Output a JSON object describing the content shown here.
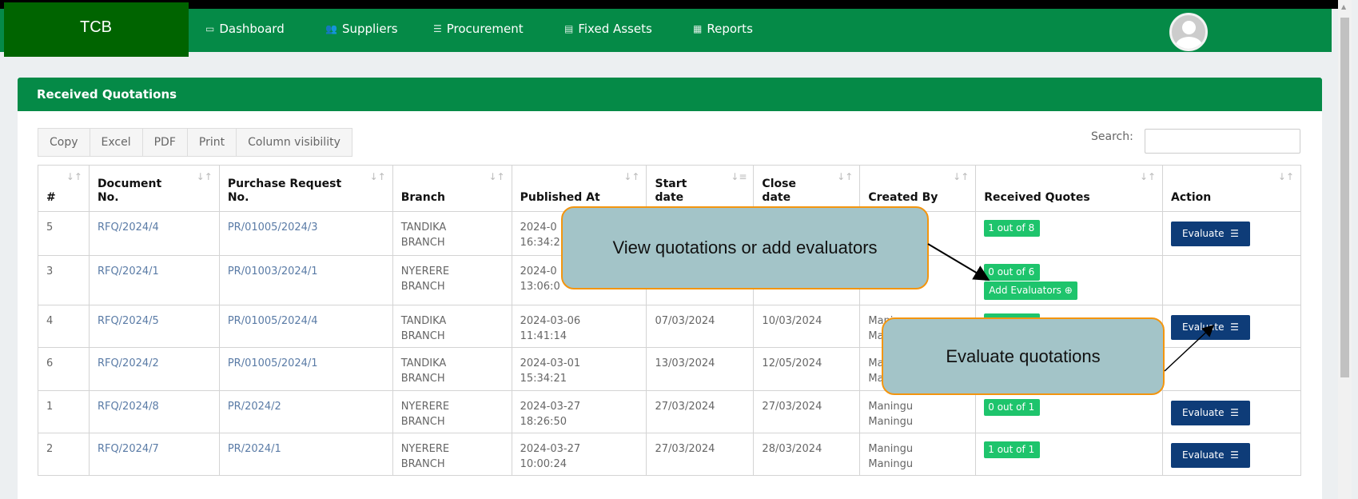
{
  "app": {
    "brand": "TCB"
  },
  "nav": [
    {
      "label": "Dashboard",
      "icon": "monitor-icon"
    },
    {
      "label": "Suppliers",
      "icon": "users-icon"
    },
    {
      "label": "Procurement",
      "icon": "list-icon"
    },
    {
      "label": "Fixed Assets",
      "icon": "building-icon"
    },
    {
      "label": "Reports",
      "icon": "report-icon"
    }
  ],
  "panel": {
    "title": "Received Quotations"
  },
  "toolbar": {
    "buttons": [
      "Copy",
      "Excel",
      "PDF",
      "Print",
      "Column visibility"
    ],
    "search_label": "Search:",
    "search_value": ""
  },
  "table": {
    "headers": [
      [
        "",
        "#"
      ],
      [
        "Document",
        "No."
      ],
      [
        "Purchase Request",
        "No."
      ],
      [
        "",
        "Branch"
      ],
      [
        "",
        "Published At"
      ],
      [
        "Start",
        "date"
      ],
      [
        "Close",
        "date"
      ],
      [
        "",
        "Created By"
      ],
      [
        "",
        "Received Quotes"
      ],
      [
        "",
        "Action"
      ]
    ],
    "rows": [
      {
        "num": "5",
        "doc": "RFQ/2024/4",
        "pr": "PR/01005/2024/3",
        "branch1": "TANDIKA",
        "branch2": "BRANCH",
        "pub1": "2024-0",
        "pub2": "16:34:2",
        "start": "",
        "close": "",
        "by1": "",
        "by2": "",
        "quotes": "1 out of 8",
        "add": "",
        "action": "Evaluate"
      },
      {
        "num": "3",
        "doc": "RFQ/2024/1",
        "pr": "PR/01003/2024/1",
        "branch1": "NYERERE",
        "branch2": "BRANCH",
        "pub1": "2024-0",
        "pub2": "13:06:0",
        "start": "",
        "close": "",
        "by1": "",
        "by2": "",
        "quotes": "0 out of 6",
        "add": "Add Evaluators",
        "action": ""
      },
      {
        "num": "4",
        "doc": "RFQ/2024/5",
        "pr": "PR/01005/2024/4",
        "branch1": "TANDIKA",
        "branch2": "BRANCH",
        "pub1": "2024-03-06",
        "pub2": "11:41:14",
        "start": "07/03/2024",
        "close": "10/03/2024",
        "by1": "Maningu",
        "by2": "Maningu",
        "quotes": "",
        "add": "",
        "action": "Evaluate"
      },
      {
        "num": "6",
        "doc": "RFQ/2024/2",
        "pr": "PR/01005/2024/1",
        "branch1": "TANDIKA",
        "branch2": "BRANCH",
        "pub1": "2024-03-01",
        "pub2": "15:34:21",
        "start": "13/03/2024",
        "close": "12/05/2024",
        "by1": "Maningu",
        "by2": "Maningu",
        "quotes": "",
        "add": "",
        "action": ""
      },
      {
        "num": "1",
        "doc": "RFQ/2024/8",
        "pr": "PR/2024/2",
        "branch1": "NYERERE",
        "branch2": "BRANCH",
        "pub1": "2024-03-27",
        "pub2": "18:26:50",
        "start": "27/03/2024",
        "close": "27/03/2024",
        "by1": "Maningu",
        "by2": "Maningu",
        "quotes": "0 out of 1",
        "add": "",
        "action": "Evaluate"
      },
      {
        "num": "2",
        "doc": "RFQ/2024/7",
        "pr": "PR/2024/1",
        "branch1": "NYERERE",
        "branch2": "BRANCH",
        "pub1": "2024-03-27",
        "pub2": "10:00:24",
        "start": "27/03/2024",
        "close": "28/03/2024",
        "by1": "Maningu",
        "by2": "Maningu",
        "quotes": "1 out of 1",
        "add": "",
        "action": "Evaluate"
      }
    ]
  },
  "callouts": {
    "view": "View quotations or add evaluators",
    "evaluate": "Evaluate quotations"
  },
  "colors": {
    "nav": "#058a47",
    "brand": "#006400",
    "badge": "#1ec46c",
    "evaluate": "#0e3c78",
    "callout_fill": "#a3c4c8",
    "callout_border": "#f3950f"
  }
}
